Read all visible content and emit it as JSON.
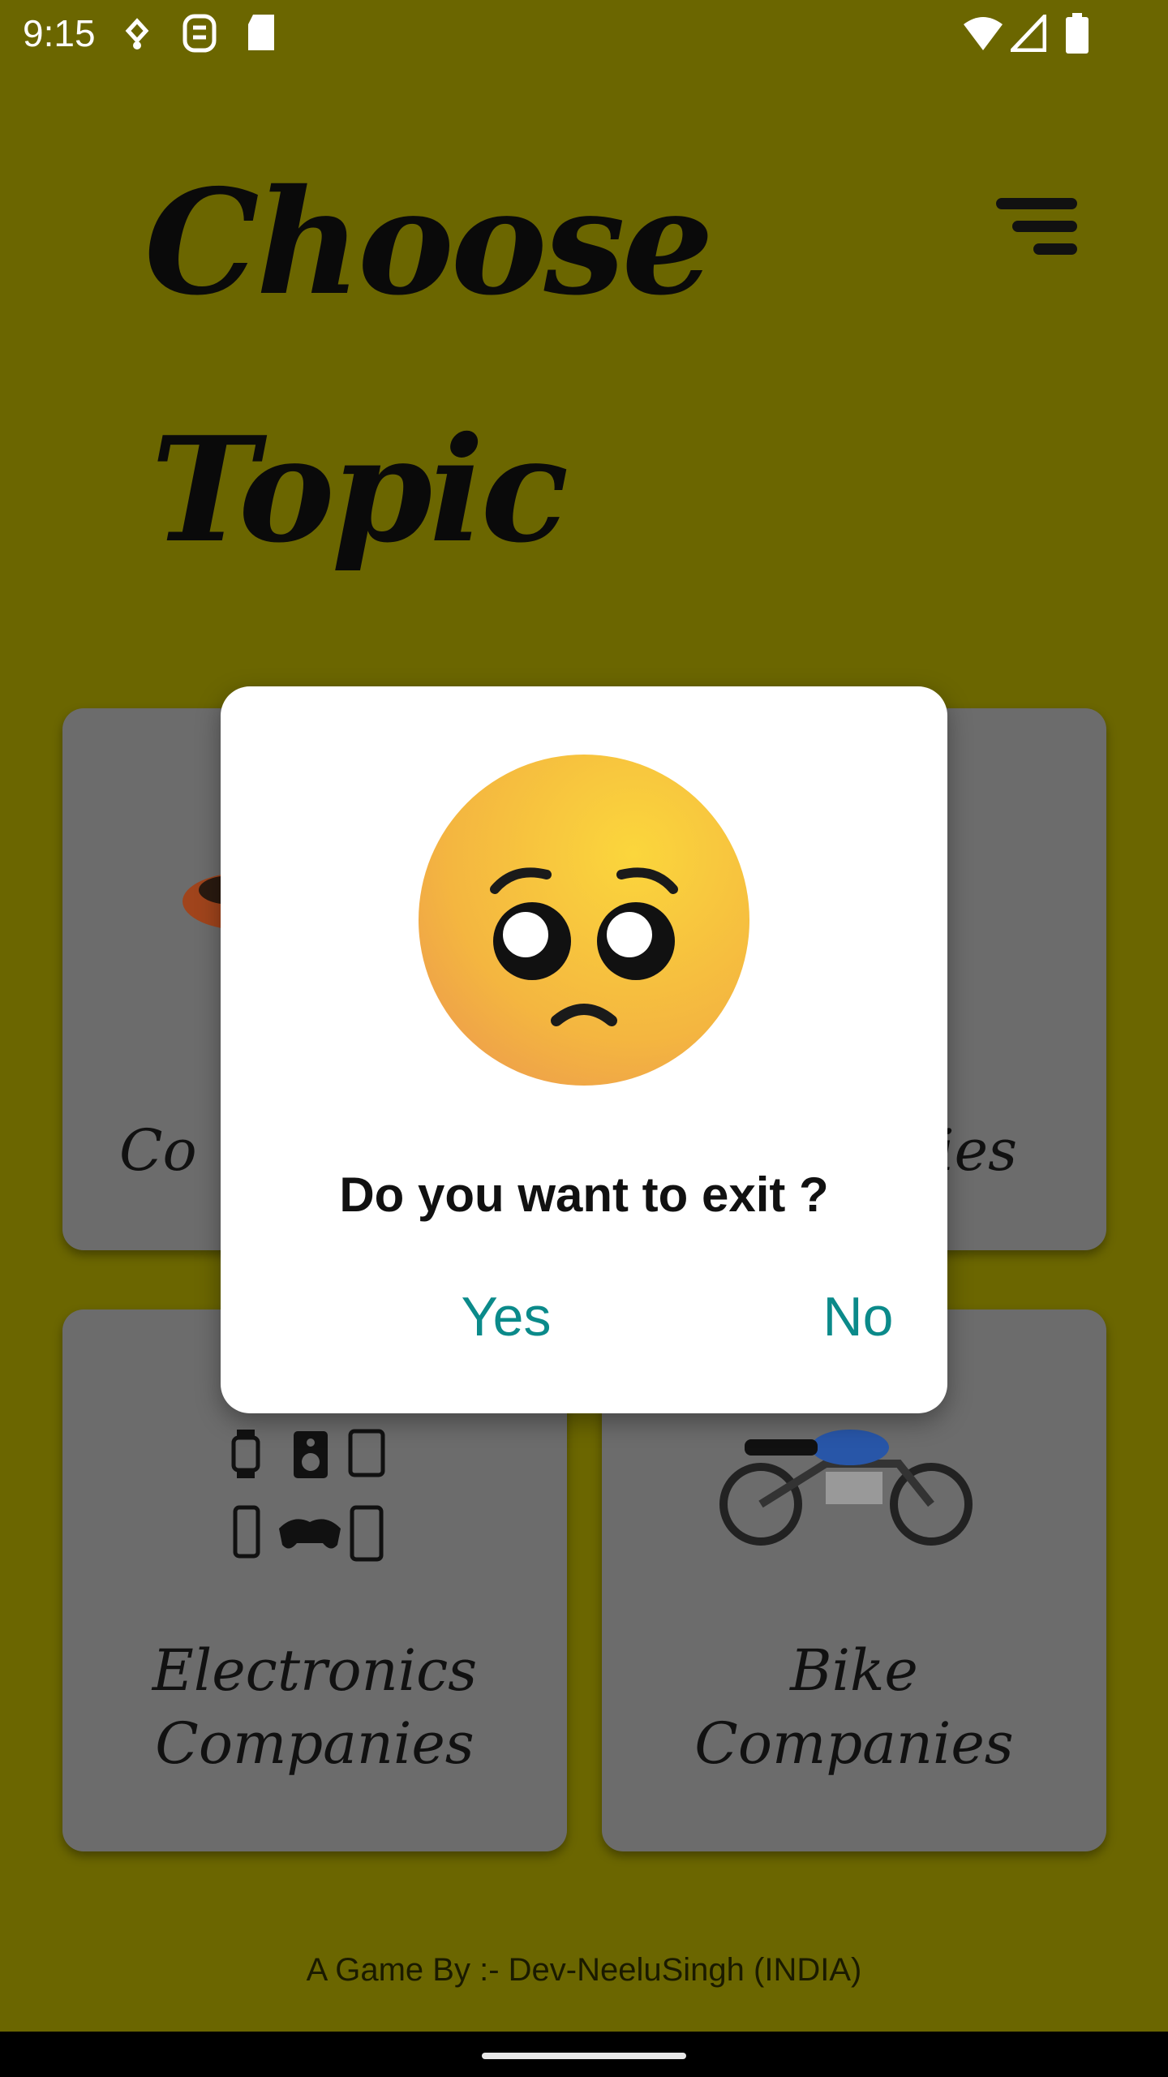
{
  "status_bar": {
    "time": "9:15"
  },
  "header": {
    "title_line1": "Choose",
    "title_line2": "Topic"
  },
  "cards": [
    {
      "label_line1": "Co",
      "label_line2": ""
    },
    {
      "label_line1": "ies",
      "label_line2": ""
    },
    {
      "label_line1": "Electronics",
      "label_line2": "Companies"
    },
    {
      "label_line1": "Bike",
      "label_line2": "Companies"
    }
  ],
  "dialog": {
    "message": "Do you want to exit ?",
    "yes_label": "Yes",
    "no_label": "No"
  },
  "footer": {
    "credit": "A Game By :- Dev-NeeluSingh (INDIA)"
  },
  "colors": {
    "background": "#6b6600",
    "card": "#6c6c6c",
    "dialog_button": "#0b8a8a"
  }
}
